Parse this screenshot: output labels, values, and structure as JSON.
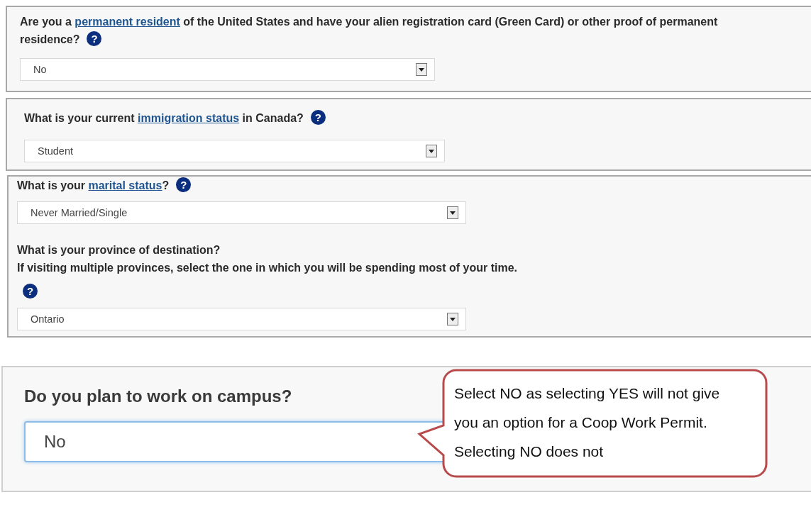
{
  "panels": [
    {
      "kind": "standard",
      "questions": [
        {
          "parts": [
            {
              "kind": "text",
              "text": "Are you a "
            },
            {
              "kind": "link",
              "text": "permanent resident"
            },
            {
              "kind": "text",
              "text": " of the United States and have your alien registration card (Green Card) or other proof of permanent residence?"
            },
            {
              "kind": "help",
              "text": "?"
            }
          ],
          "select": {
            "value": "No"
          }
        }
      ]
    },
    {
      "kind": "standard",
      "questions": [
        {
          "parts": [
            {
              "kind": "text",
              "text": "What is your current "
            },
            {
              "kind": "link",
              "text": "immigration status"
            },
            {
              "kind": "text",
              "text": " in Canada?"
            },
            {
              "kind": "help",
              "text": "?"
            }
          ],
          "select": {
            "value": "Student"
          }
        }
      ]
    },
    {
      "kind": "standard",
      "questions": [
        {
          "parts": [
            {
              "kind": "text",
              "text": "What is your "
            },
            {
              "kind": "link",
              "text": "marital status"
            },
            {
              "kind": "text",
              "text": "?"
            },
            {
              "kind": "help",
              "text": "?"
            }
          ],
          "select": {
            "value": "Never Married/Single"
          }
        },
        {
          "parts": [
            {
              "kind": "text",
              "text": "What is your province of destination?"
            },
            {
              "kind": "break"
            },
            {
              "kind": "text",
              "text": "If visiting multiple provinces, select the one in which you will be spending most of your time."
            },
            {
              "kind": "break"
            },
            {
              "kind": "help",
              "text": "?"
            }
          ],
          "select": {
            "value": "Ontario"
          }
        }
      ]
    },
    {
      "kind": "large",
      "questions": [
        {
          "parts": [
            {
              "kind": "text",
              "text": "Do you plan to work on campus?"
            }
          ],
          "select": {
            "value": "No"
          }
        }
      ]
    }
  ],
  "callout": {
    "text": "Select NO as selecting YES will not give you an option for a Coop Work Permit. Selecting NO does not"
  }
}
